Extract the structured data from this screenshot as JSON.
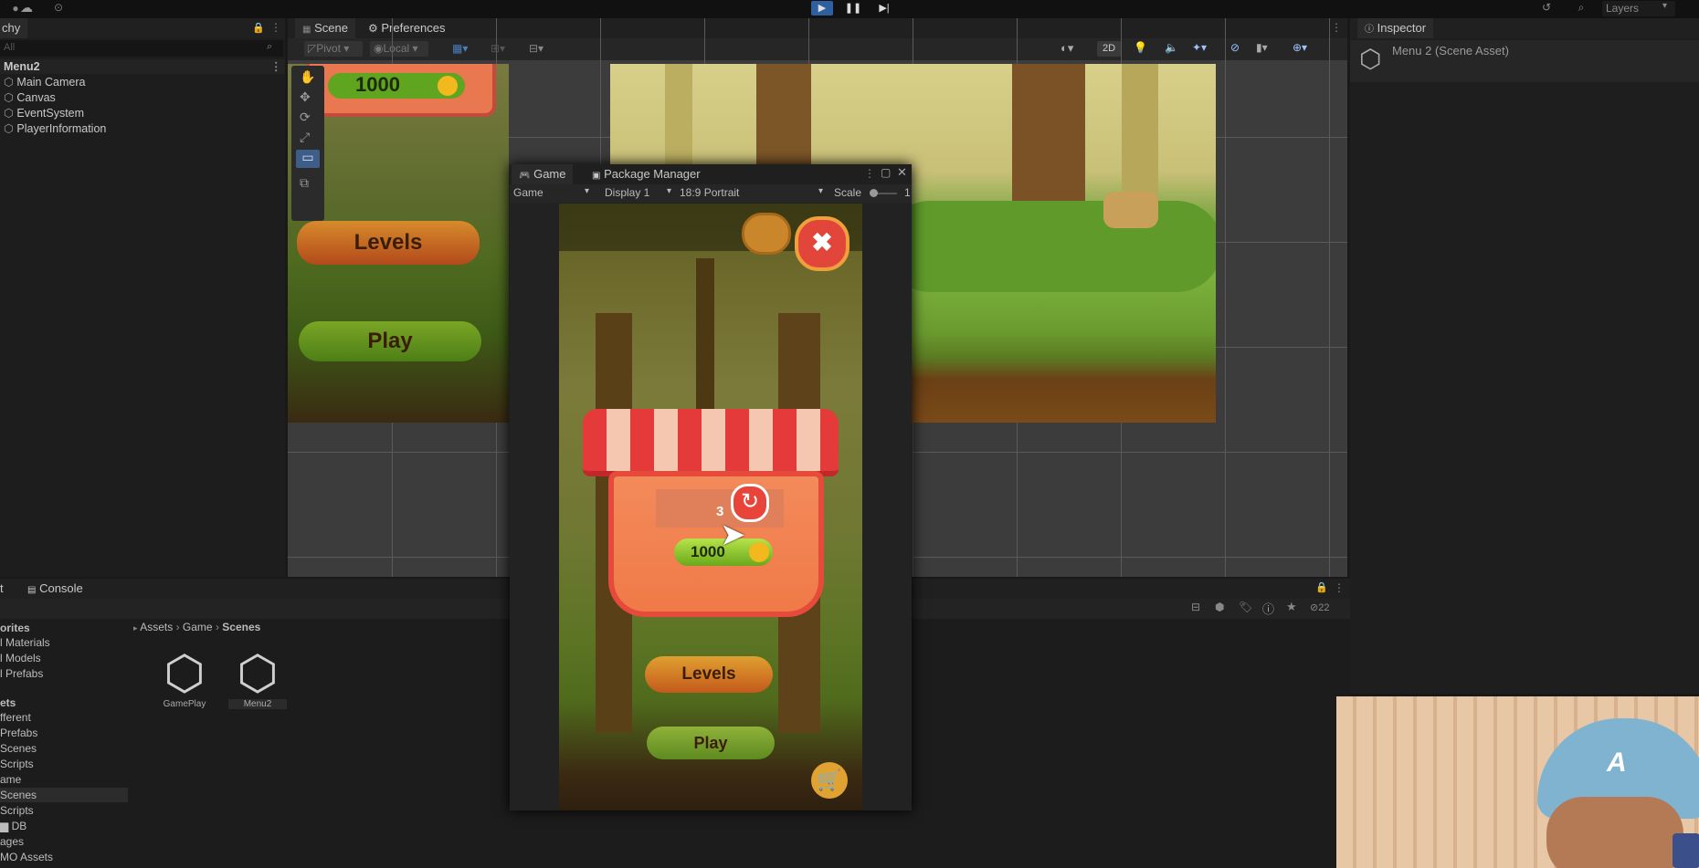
{
  "toolbar": {
    "layers_label": "Layers"
  },
  "hierarchy": {
    "title": "chy",
    "search_placeholder": "All",
    "scene": "Menu2",
    "items": [
      "Main Camera",
      "Canvas",
      "EventSystem",
      "PlayerInformation"
    ]
  },
  "scene_tabs": {
    "scene": "Scene",
    "preferences": "Preferences"
  },
  "scene_toolbar": {
    "pivot": "Pivot",
    "local": "Local",
    "mode_2d": "2D"
  },
  "scene_view": {
    "coins_top": "1000",
    "levels": "Levels",
    "play": "Play"
  },
  "game_window": {
    "tab_game": "Game",
    "tab_package": "Package Manager",
    "display_mode": "Game",
    "display": "Display 1",
    "aspect": "18:9 Portrait",
    "scale_label": "Scale",
    "scale_value": "1",
    "reward_count": "3",
    "coins": "1000",
    "levels": "Levels",
    "play": "Play"
  },
  "inspector": {
    "title": "Inspector",
    "asset": "Menu 2 (Scene Asset)"
  },
  "project": {
    "tab_console": "Console",
    "breadcrumb": [
      "Assets",
      "Game",
      "Scenes"
    ],
    "folders": [
      "orites",
      "l Materials",
      "l Models",
      "l Prefabs",
      "ets",
      "fferent",
      "Prefabs",
      "Scenes",
      "Scripts",
      "ame",
      "Scenes",
      "Scripts",
      "DB",
      "ages",
      "MO Assets"
    ],
    "assets": [
      {
        "name": "GamePlay"
      },
      {
        "name": "Menu2"
      }
    ],
    "count": "22"
  },
  "colors": {
    "accent": "#3a6fb0",
    "bg": "#191919",
    "panel": "#1e1e1e",
    "scene_bg": "#3c3c3c"
  }
}
